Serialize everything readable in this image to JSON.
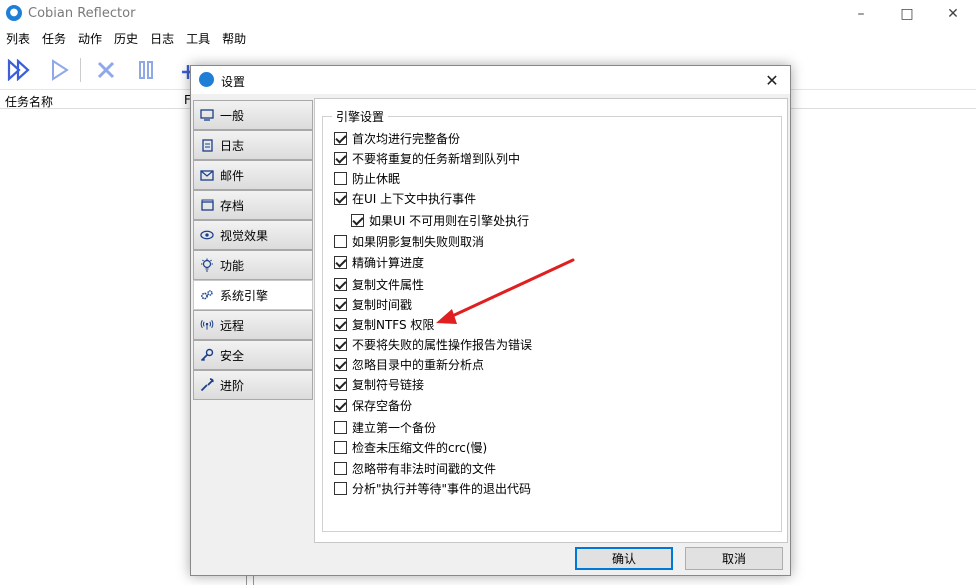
{
  "app": {
    "title": "Cobian Reflector"
  },
  "menu": [
    "列表",
    "任务",
    "动作",
    "历史",
    "日志",
    "工具",
    "帮助"
  ],
  "list": {
    "col1": "任务名称",
    "col2": "F"
  },
  "dialog": {
    "title": "设置",
    "nav": [
      {
        "label": "一般",
        "icon": "monitor-icon"
      },
      {
        "label": "日志",
        "icon": "log-icon"
      },
      {
        "label": "邮件",
        "icon": "mail-icon"
      },
      {
        "label": "存档",
        "icon": "archive-icon"
      },
      {
        "label": "视觉效果",
        "icon": "eye-icon"
      },
      {
        "label": "功能",
        "icon": "bulb-icon"
      },
      {
        "label": "系统引擎",
        "icon": "gears-icon",
        "active": true
      },
      {
        "label": "远程",
        "icon": "antenna-icon"
      },
      {
        "label": "安全",
        "icon": "key-icon"
      },
      {
        "label": "进阶",
        "icon": "wrench-icon"
      }
    ],
    "group_title": "引擎设置",
    "options": [
      {
        "label": "首次均进行完整备份",
        "checked": true
      },
      {
        "label": "不要将重复的任务新增到队列中",
        "checked": true
      },
      {
        "label": "防止休眠",
        "checked": false
      },
      {
        "label": "在UI 上下文中执行事件",
        "checked": true
      },
      {
        "label": "如果UI 不可用则在引擎处执行",
        "checked": true,
        "indent": true
      },
      {
        "label": "如果阴影复制失败则取消",
        "checked": false
      },
      {
        "label": "精确计算进度",
        "checked": true
      },
      {
        "label": "复制文件属性",
        "checked": true
      },
      {
        "label": "复制时间戳",
        "checked": true
      },
      {
        "label": "复制NTFS 权限",
        "checked": true
      },
      {
        "label": "不要将失败的属性操作报告为错误",
        "checked": true
      },
      {
        "label": "忽略目录中的重新分析点",
        "checked": true
      },
      {
        "label": "复制符号链接",
        "checked": true
      },
      {
        "label": "保存空备份",
        "checked": true
      },
      {
        "label": "建立第一个备份",
        "checked": false
      },
      {
        "label": "检查未压缩文件的crc(慢)",
        "checked": false
      },
      {
        "label": "忽略带有非法时间戳的文件",
        "checked": false
      },
      {
        "label": "分析\"执行并等待\"事件的退出代码",
        "checked": false
      }
    ],
    "ok_label": "确认",
    "cancel_label": "取消"
  },
  "colors": {
    "accent": "#0078d7",
    "toolbar_blue": "#3a5fd8",
    "arrow": "#e02020"
  }
}
